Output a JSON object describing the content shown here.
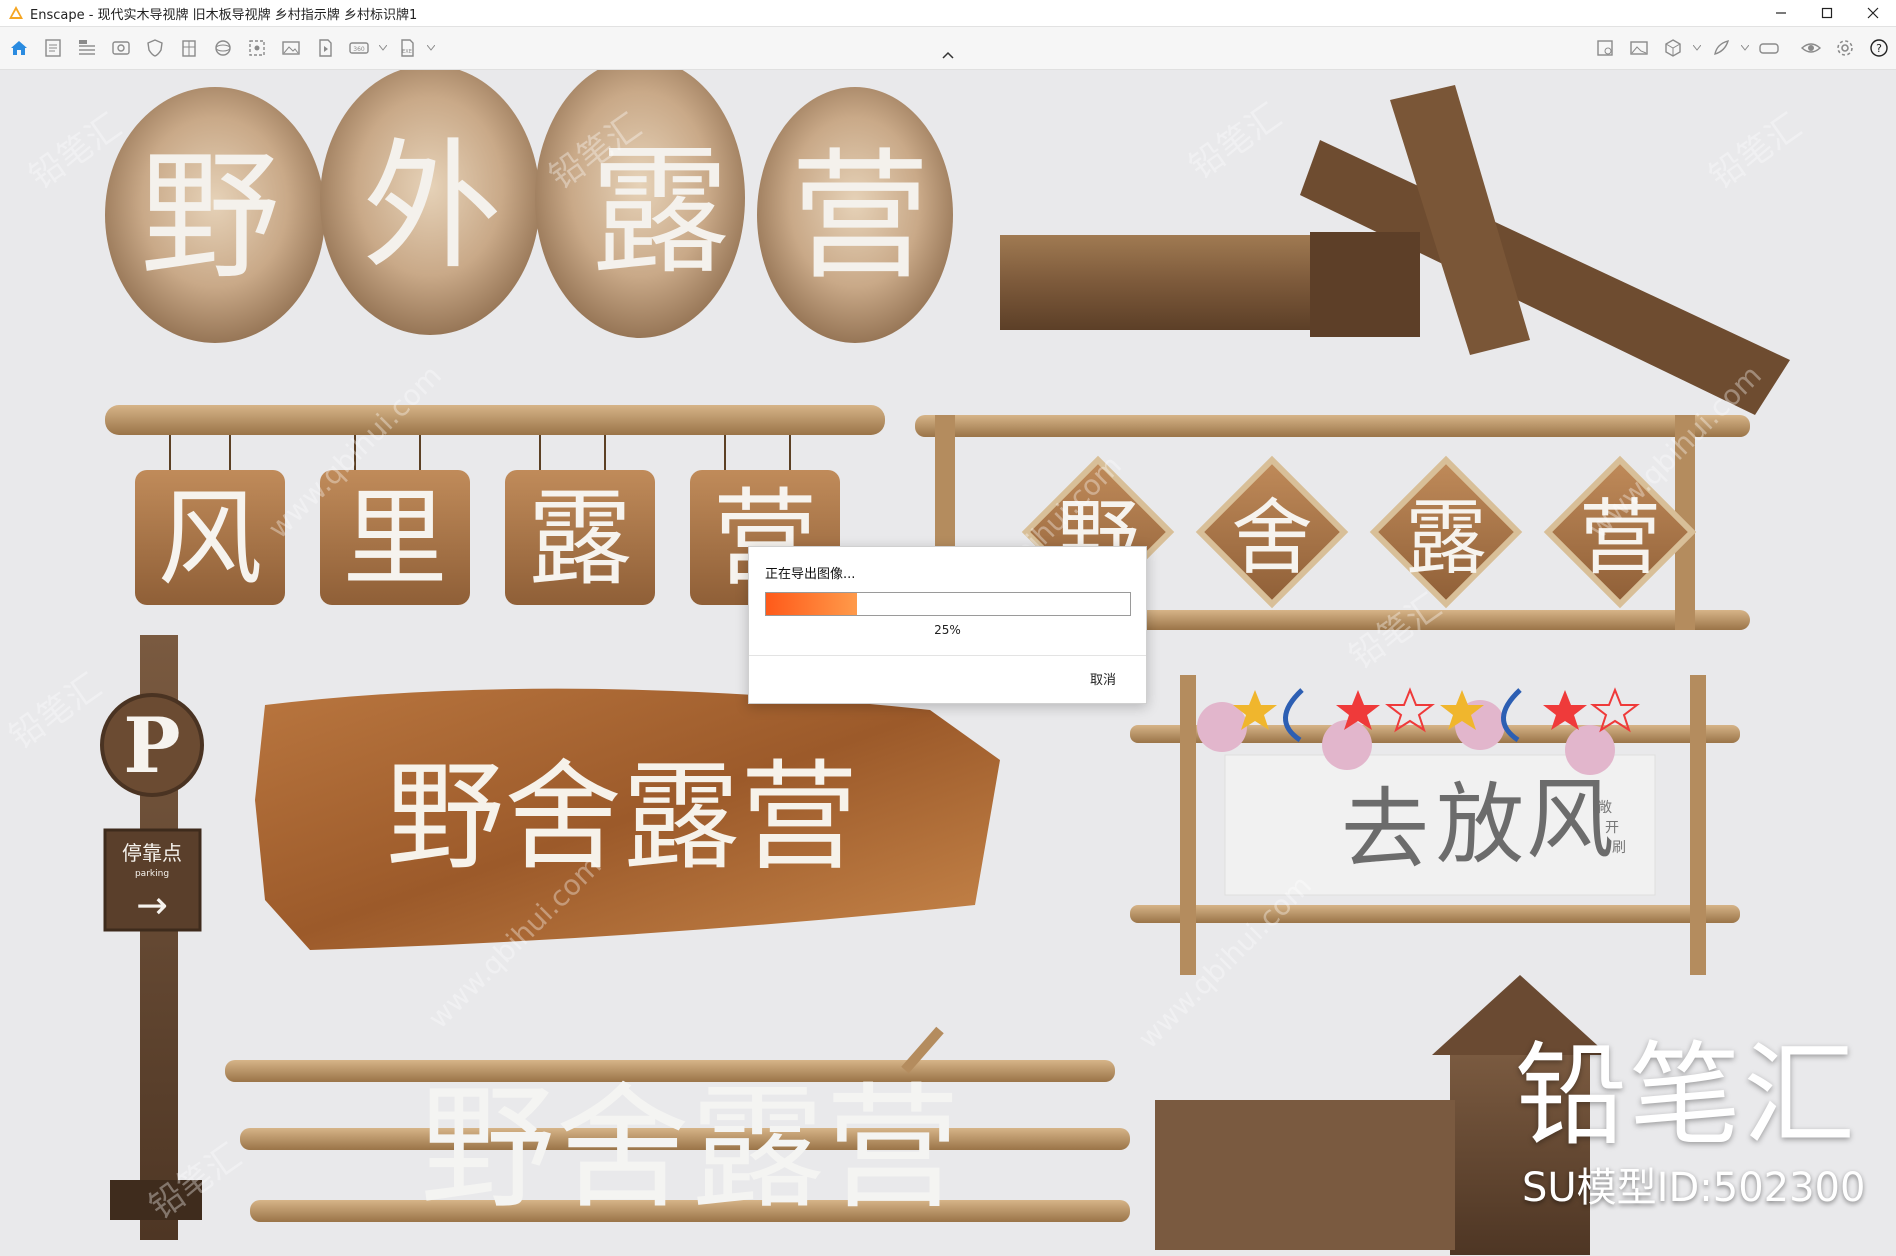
{
  "window": {
    "title": "Enscape - 现代实木导视牌 旧木板导视牌 乡村指示牌 乡村标识牌1",
    "controls": {
      "minimize": "minimize-icon",
      "maximize": "maximize-icon",
      "close": "close-icon"
    }
  },
  "toolbar": {
    "left_icons": [
      "home-icon",
      "document-icon",
      "bim-icon",
      "media-icon",
      "shield-icon",
      "building-icon",
      "sphere-icon",
      "image-export-icon",
      "image-icon",
      "video-icon",
      "panorama-icon",
      "exe-icon"
    ],
    "right_icons": [
      "visual-settings-icon",
      "image-icon",
      "cube-icon",
      "feather-icon",
      "vr-icon",
      "eye-icon",
      "gear-icon",
      "help-icon"
    ]
  },
  "scene": {
    "sign_1": [
      "野",
      "外",
      "露",
      "营"
    ],
    "sign_2": [
      "风",
      "里",
      "露",
      "营"
    ],
    "sign_3": [
      "野",
      "舍",
      "露",
      "营"
    ],
    "sign_4": "野舍露营",
    "sign_5": "野舍露营",
    "sign_6": [
      "去",
      "放",
      "风"
    ],
    "sign_6_side": [
      "敞",
      "开",
      "刷"
    ],
    "parking": {
      "letter": "P",
      "label": "停靠点",
      "sub": "parking",
      "arrow": "→"
    },
    "watermark_a": "铅笔汇",
    "watermark_b": "www.qbihui.com"
  },
  "export_dialog": {
    "title": "正在导出图像...",
    "progress_percent": 25,
    "progress_text": "25%",
    "cancel_label": "取消",
    "fill_colors": [
      "#ff5a1a",
      "#ff9a4a"
    ]
  },
  "branding": {
    "name": "铅笔汇",
    "model_id": "SU模型ID:502300"
  }
}
